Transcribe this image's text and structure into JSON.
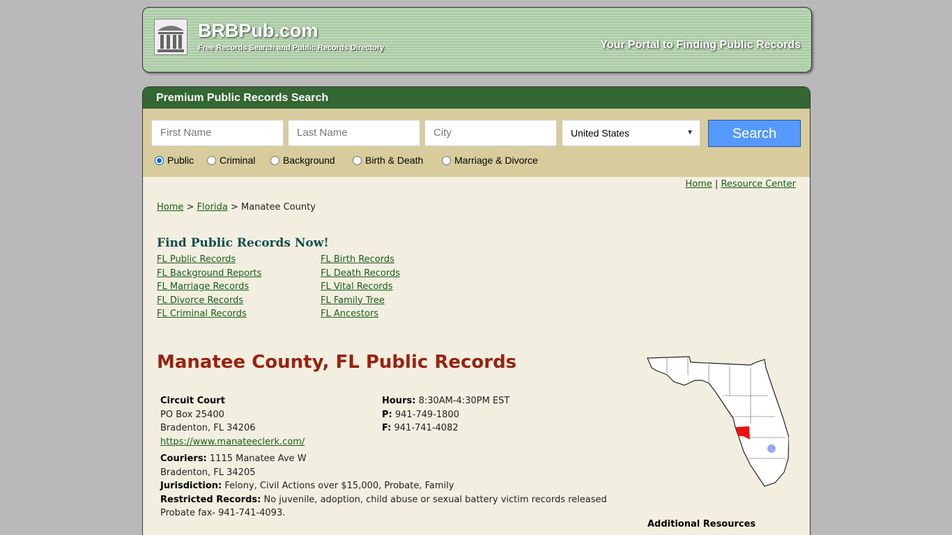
{
  "header": {
    "brand": "BRBPub.com",
    "tagline": "Free Records Search and Public Records Directory",
    "portal": "Your Portal to Finding Public Records"
  },
  "search": {
    "title": "Premium Public Records Search",
    "first_name_placeholder": "First Name",
    "last_name_placeholder": "Last Name",
    "city_placeholder": "City",
    "country": "United States",
    "button": "Search",
    "types": [
      {
        "label": "Public",
        "checked": true
      },
      {
        "label": "Criminal"
      },
      {
        "label": "Background"
      },
      {
        "label": "Birth & Death"
      },
      {
        "label": "Marriage & Divorce"
      }
    ]
  },
  "toplinks": {
    "home": "Home",
    "sep": "|",
    "resource": "Resource Center"
  },
  "breadcrumb": {
    "home": "Home",
    "state": "Florida",
    "current": "Manatee County",
    "sep": ">"
  },
  "find": {
    "title": "Find Public Records Now!",
    "left": [
      "FL Public Records",
      "FL Background Reports",
      "FL Marriage Records",
      "FL Divorce Records",
      "FL Criminal Records"
    ],
    "right": [
      "FL Birth Records",
      "FL Death Records",
      "FL Vital Records",
      "FL Family Tree",
      "FL Ancestors"
    ]
  },
  "page_title": "Manatee County, FL Public Records",
  "court": {
    "name": "Circuit Court",
    "address1": "PO Box 25400",
    "address2": "Bradenton, FL 34206",
    "url": "https://www.manateeclerk.com/",
    "hours_label": "Hours:",
    "hours": "8:30AM-4:30PM EST",
    "phone_label": "P:",
    "phone": "941-749-1800",
    "fax_label": "F:",
    "fax": "941-741-4082",
    "couriers_label": "Couriers:",
    "couriers1": "1115 Manatee Ave W",
    "couriers2": "Bradenton, FL 34205",
    "jurisdiction_label": "Jurisdiction:",
    "jurisdiction": "Felony, Civil Actions over $15,000, Probate, Family",
    "restricted_label": "Restricted Records:",
    "restricted": "No juvenile, adoption, child abuse or sexual battery victim records released",
    "probate_fax": "Probate fax- 941-741-4093."
  },
  "additional": "Additional Resources",
  "colors": {
    "header_green": "#336633",
    "title_red": "#992211",
    "highlight_county": "#ee1111"
  }
}
